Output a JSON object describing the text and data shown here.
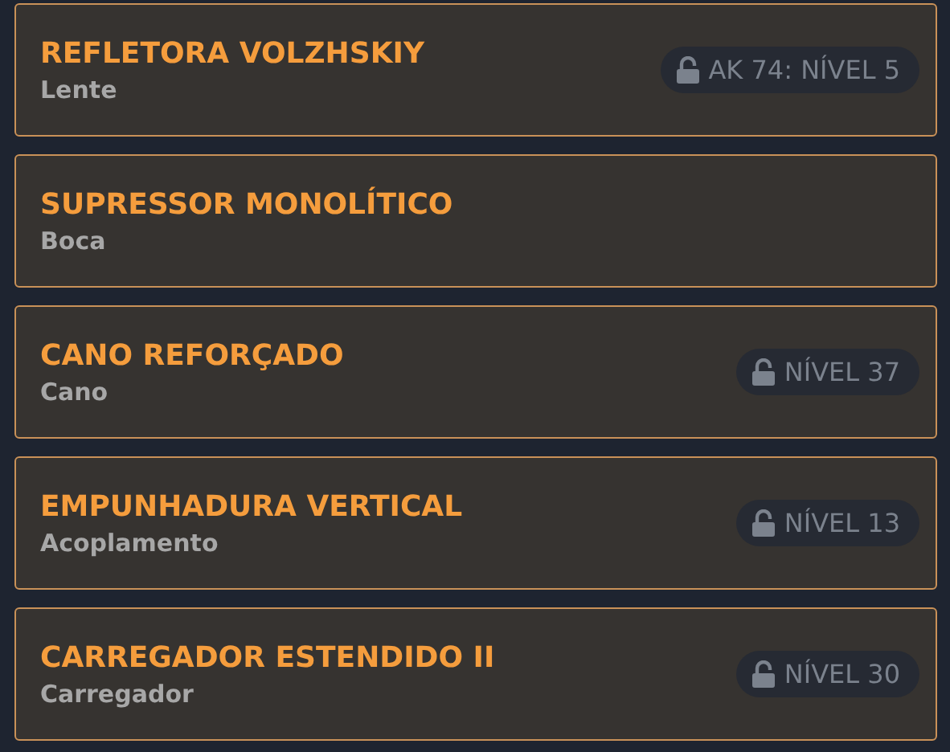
{
  "items": [
    {
      "name": "REFLETORA VOLZHSKIY",
      "slot": "Lente",
      "badge": "AK 74: NÍVEL 5"
    },
    {
      "name": "SUPRESSOR MONOLÍTICO",
      "slot": "Boca"
    },
    {
      "name": "CANO REFORÇADO",
      "slot": "Cano",
      "badge": "NÍVEL 37"
    },
    {
      "name": "EMPUNHADURA VERTICAL",
      "slot": "Acoplamento",
      "badge": "NÍVEL 13"
    },
    {
      "name": "CARREGADOR ESTENDIDO II",
      "slot": "Carregador",
      "badge": "NÍVEL 30"
    }
  ]
}
